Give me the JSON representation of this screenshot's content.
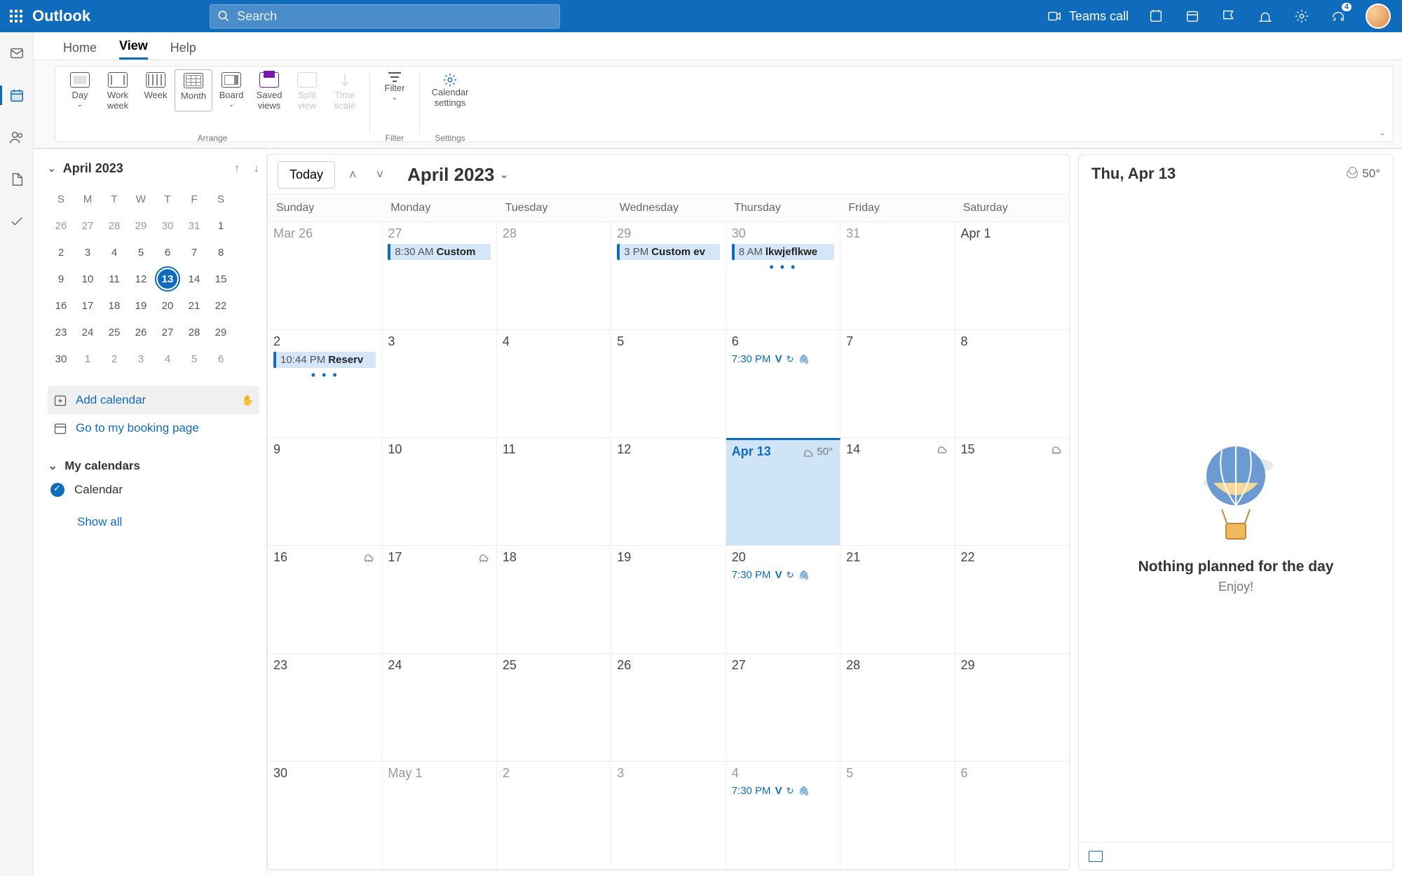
{
  "header": {
    "app_name": "Outlook",
    "search_placeholder": "Search",
    "teams_label": "Teams call",
    "headset_badge": "4"
  },
  "tabs": {
    "home": "Home",
    "view": "View",
    "help": "Help"
  },
  "ribbon": {
    "day": "Day",
    "work_week_1": "Work",
    "work_week_2": "week",
    "week": "Week",
    "month": "Month",
    "board": "Board",
    "saved_1": "Saved",
    "saved_2": "views",
    "split_1": "Split",
    "split_2": "view",
    "time_1": "Time",
    "time_2": "scale",
    "filter": "Filter",
    "calset_1": "Calendar",
    "calset_2": "settings",
    "group_arrange": "Arrange",
    "group_filter": "Filter",
    "group_settings": "Settings"
  },
  "leftrail": [
    "mail",
    "calendar",
    "people",
    "files",
    "todo"
  ],
  "mini": {
    "month": "April 2023",
    "dow": [
      "S",
      "M",
      "T",
      "W",
      "T",
      "F",
      "S"
    ],
    "rows": [
      [
        "26",
        "27",
        "28",
        "29",
        "30",
        "31",
        "1"
      ],
      [
        "2",
        "3",
        "4",
        "5",
        "6",
        "7",
        "8"
      ],
      [
        "9",
        "10",
        "11",
        "12",
        "13",
        "14",
        "15"
      ],
      [
        "16",
        "17",
        "18",
        "19",
        "20",
        "21",
        "22"
      ],
      [
        "23",
        "24",
        "25",
        "26",
        "27",
        "28",
        "29"
      ],
      [
        "30",
        "1",
        "2",
        "3",
        "4",
        "5",
        "6"
      ]
    ],
    "today": "13"
  },
  "side": {
    "add_calendar": "Add calendar",
    "booking": "Go to my booking page",
    "my_calendars": "My calendars",
    "cal_item": "Calendar",
    "show_all": "Show all"
  },
  "main": {
    "today": "Today",
    "month": "April 2023",
    "dow": [
      "Sunday",
      "Monday",
      "Tuesday",
      "Wednesday",
      "Thursday",
      "Friday",
      "Saturday"
    ],
    "weeks": [
      {
        "days": [
          {
            "n": "Mar 26",
            "off": true
          },
          {
            "n": "27",
            "off": true,
            "events": [
              {
                "t": "8:30 AM",
                "title": "Custom"
              }
            ]
          },
          {
            "n": "28",
            "off": true
          },
          {
            "n": "29",
            "off": true,
            "events": [
              {
                "t": "3 PM",
                "title": "Custom ev"
              }
            ]
          },
          {
            "n": "30",
            "off": true,
            "events": [
              {
                "t": "8 AM",
                "title": "lkwjeflkwe"
              }
            ],
            "more": true
          },
          {
            "n": "31",
            "off": true
          },
          {
            "n": "Apr 1"
          }
        ]
      },
      {
        "days": [
          {
            "n": "2",
            "events": [
              {
                "t": "10:44 PM",
                "title": "Reserv"
              }
            ],
            "more": true
          },
          {
            "n": "3"
          },
          {
            "n": "4"
          },
          {
            "n": "5"
          },
          {
            "n": "6",
            "linkev": {
              "t": "7:30 PM",
              "title": "V"
            }
          },
          {
            "n": "7"
          },
          {
            "n": "8"
          }
        ]
      },
      {
        "days": [
          {
            "n": "9"
          },
          {
            "n": "10"
          },
          {
            "n": "11"
          },
          {
            "n": "12"
          },
          {
            "n": "Apr 13",
            "today": true,
            "wx": "50°",
            "wxicon": "cloud"
          },
          {
            "n": "14",
            "wxicon": "cloud"
          },
          {
            "n": "15",
            "wxicon": "cloud-rain"
          }
        ]
      },
      {
        "days": [
          {
            "n": "16",
            "wxicon": "cloud-rain"
          },
          {
            "n": "17",
            "wxicon": "cloud-rain"
          },
          {
            "n": "18"
          },
          {
            "n": "19"
          },
          {
            "n": "20",
            "linkev": {
              "t": "7:30 PM",
              "title": "V"
            }
          },
          {
            "n": "21"
          },
          {
            "n": "22"
          }
        ]
      },
      {
        "days": [
          {
            "n": "23"
          },
          {
            "n": "24"
          },
          {
            "n": "25"
          },
          {
            "n": "26"
          },
          {
            "n": "27"
          },
          {
            "n": "28"
          },
          {
            "n": "29"
          }
        ]
      },
      {
        "days": [
          {
            "n": "30"
          },
          {
            "n": "May 1",
            "off": true
          },
          {
            "n": "2",
            "off": true
          },
          {
            "n": "3",
            "off": true
          },
          {
            "n": "4",
            "off": true,
            "linkev": {
              "t": "7:30 PM",
              "title": "V"
            }
          },
          {
            "n": "5",
            "off": true
          },
          {
            "n": "6",
            "off": true
          }
        ]
      }
    ]
  },
  "agenda": {
    "title": "Thu, Apr 13",
    "wx": "50°",
    "msg1": "Nothing planned for the day",
    "msg2": "Enjoy!"
  }
}
